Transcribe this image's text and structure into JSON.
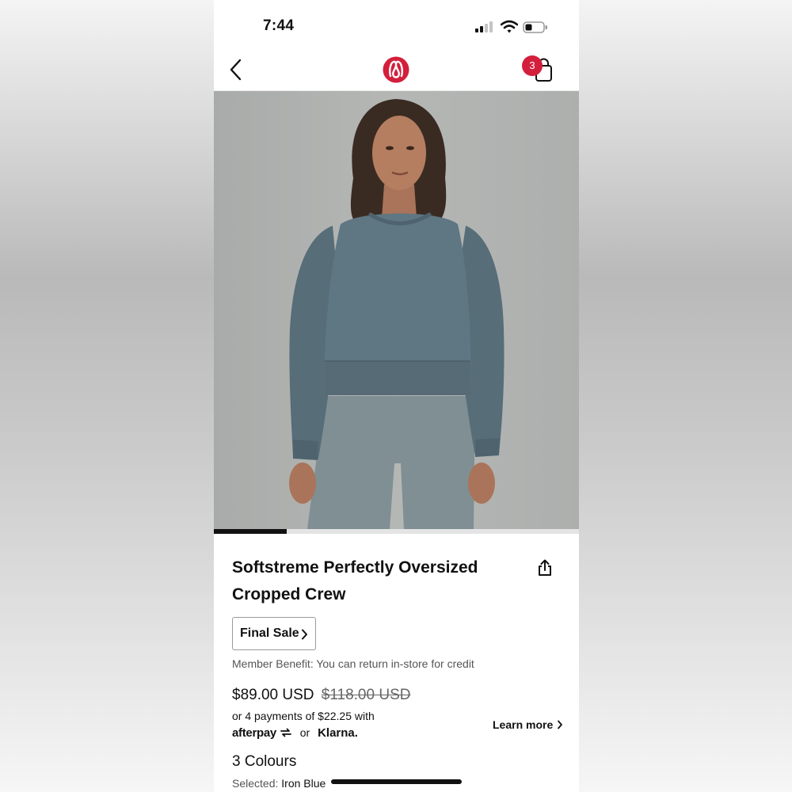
{
  "status_bar": {
    "time": "7:44"
  },
  "nav": {
    "cart_count": "3"
  },
  "product": {
    "title": "Softstreme Perfectly Oversized Cropped Crew",
    "final_sale_label": "Final Sale",
    "member_benefit": "Member Benefit: You can return in-store for credit",
    "price": "$89.00 USD",
    "original_price": "$118.00 USD",
    "installments_text": "or 4 payments of $22.25 with",
    "afterpay_label": "afterpay",
    "or_label": "or",
    "klarna_label": "Klarna.",
    "learn_more_label": "Learn more",
    "colours_heading": "3 Colours",
    "selected_label": "Selected:",
    "selected_colour": "Iron Blue"
  },
  "carousel": {
    "progress": 0.2
  },
  "icons": {
    "back": "chevron-left-icon",
    "logo": "lululemon-logo",
    "bag": "shopping-bag-icon",
    "share": "share-icon",
    "final_sale_chevron": "chevron-right-icon",
    "learn_more_chevron": "chevron-right-icon"
  },
  "colors": {
    "brand_red": "#d31f3b",
    "sweater": "#5f7683",
    "pants": "#7f8f93",
    "background": "#b3b5b4"
  }
}
